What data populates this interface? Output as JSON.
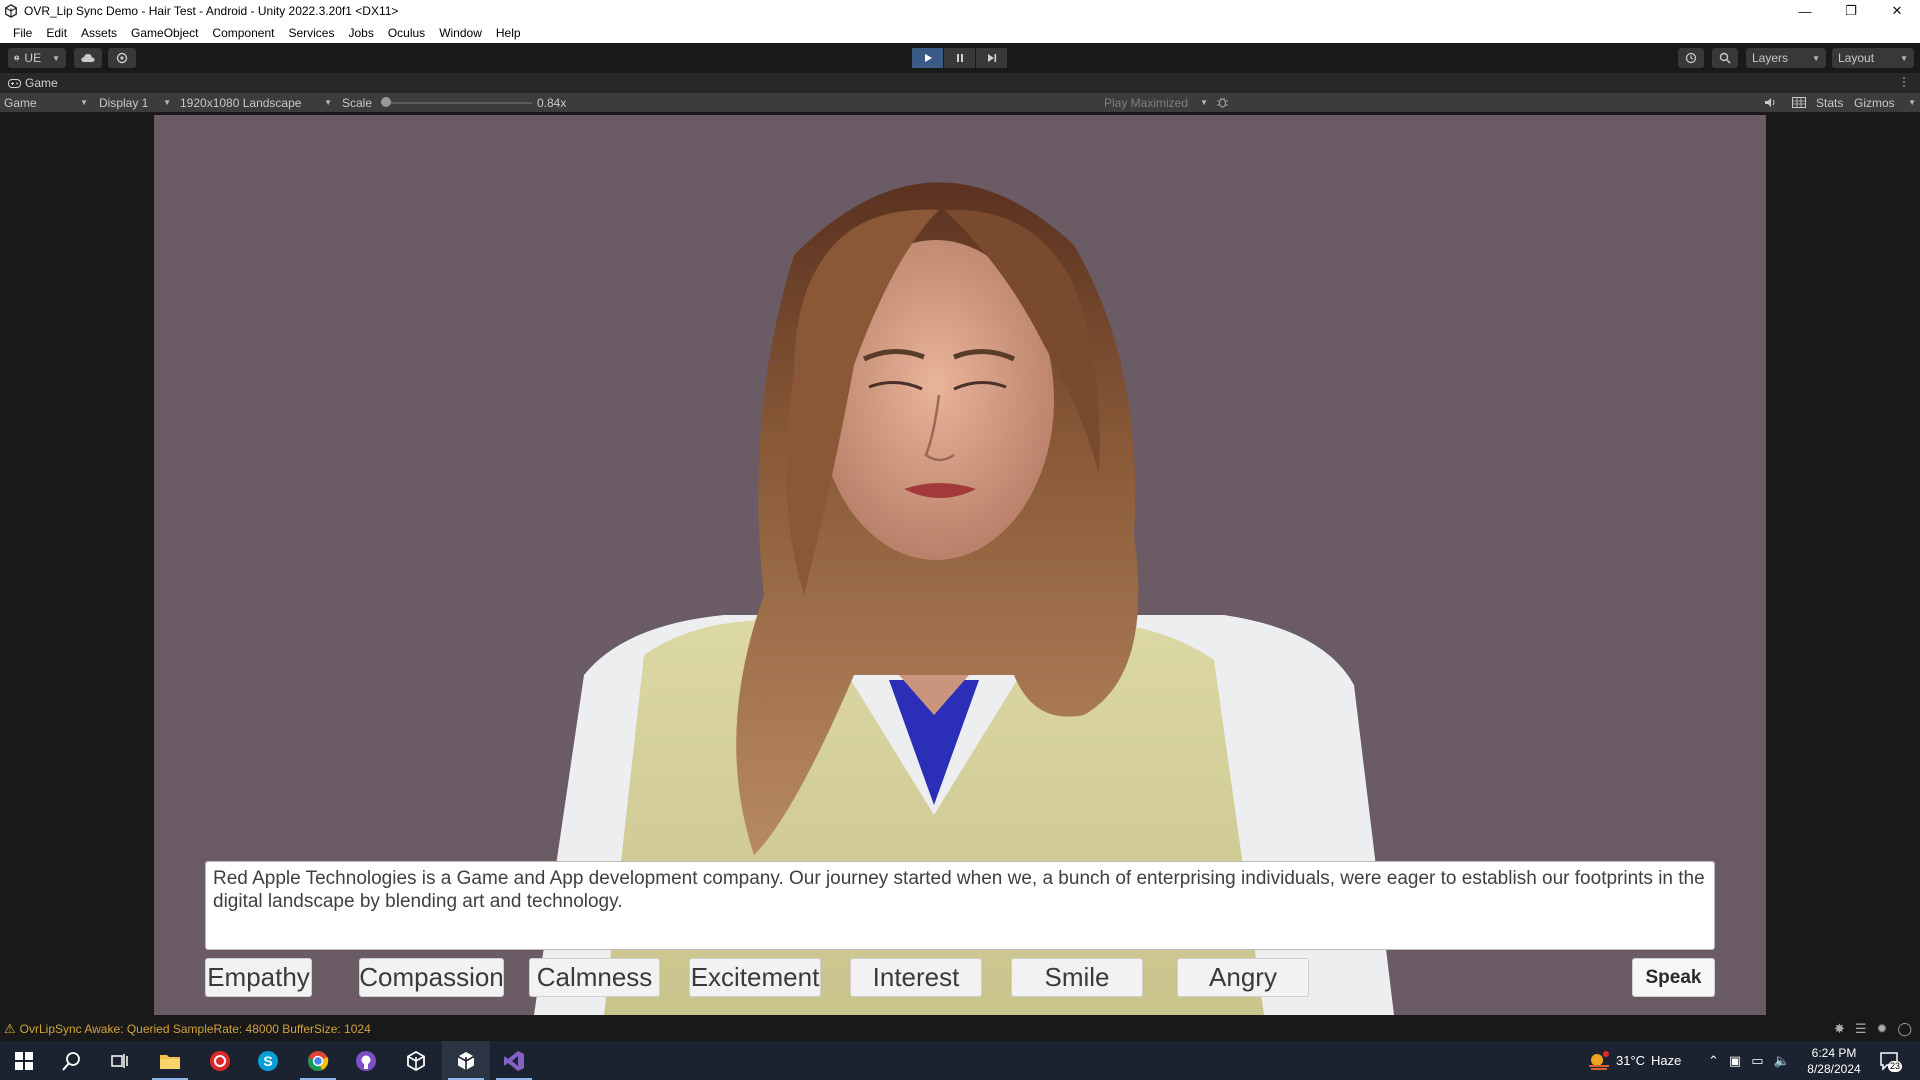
{
  "window": {
    "title": "OVR_Lip Sync Demo - Hair Test - Android - Unity 2022.3.20f1 <DX11>",
    "controls": [
      "minimize",
      "restore",
      "close"
    ]
  },
  "menu": [
    "File",
    "Edit",
    "Assets",
    "GameObject",
    "Component",
    "Services",
    "Jobs",
    "Oculus",
    "Window",
    "Help"
  ],
  "toolbar": {
    "account_label": "UE",
    "layers_label": "Layers",
    "layout_label": "Layout",
    "play_state": "playing"
  },
  "game_tab": {
    "label": "Game"
  },
  "game_view_bar": {
    "view_mode": "Game",
    "display": "Display 1",
    "resolution": "1920x1080 Landscape",
    "scale_label": "Scale",
    "scale_value": "0.84x",
    "play_mode": "Play Maximized",
    "stats_label": "Stats",
    "gizmos_label": "Gizmos"
  },
  "scene": {
    "background_color": "#6b5b65",
    "speech_text": "Red Apple Technologies is a Game and App development company. Our journey started when we, a bunch of enterprising individuals, were eager to establish our footprints in the digital landscape by blending art and technology.",
    "emotion_buttons": [
      "Empathy",
      "Compassion",
      "Calmness",
      "Excitement",
      "Interest",
      "Smile",
      "Angry"
    ],
    "speak_label": "Speak"
  },
  "status": {
    "message": "OvrLipSync Awake: Queried SampleRate: 48000 BufferSize: 1024",
    "level": "warning"
  },
  "taskbar": {
    "apps": [
      "start",
      "search",
      "task-view",
      "file-explorer",
      "red-app",
      "skype",
      "chrome",
      "github-desktop",
      "unity-hub",
      "unity",
      "visual-studio"
    ],
    "weather_temp": "31°C",
    "weather_desc": "Haze",
    "time": "6:24 PM",
    "date": "8/28/2024",
    "notification_count": "23"
  }
}
